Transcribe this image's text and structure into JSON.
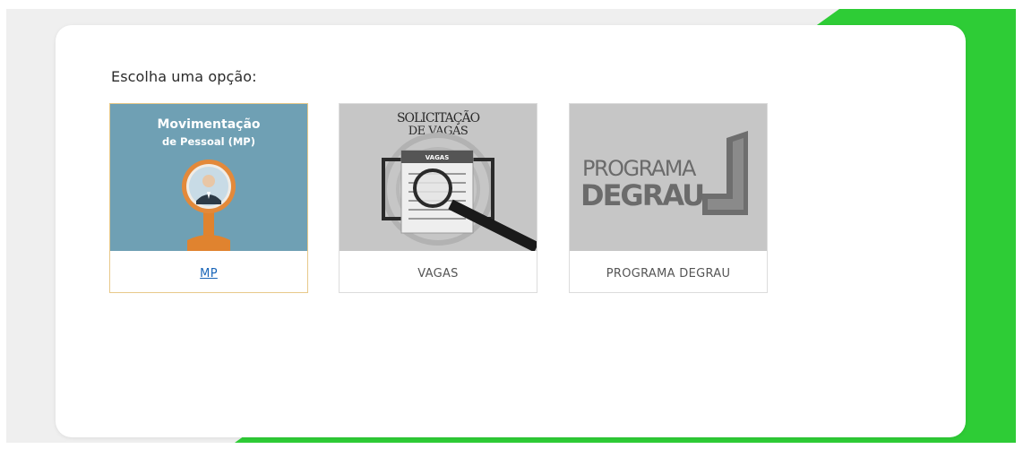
{
  "prompt": "Escolha uma opção:",
  "colors": {
    "accent_green": "#2ecc36",
    "mp_thumb_bg": "#6fa0b4",
    "card_bg": "#ffffff"
  },
  "options": [
    {
      "label": "MP",
      "thumb_title_line1": "Movimentação",
      "thumb_title_line2": "de Pessoal (MP)",
      "thumb_icon": "magnifier-person-icon",
      "selected": true
    },
    {
      "label": "VAGAS",
      "thumb_title_line1": "SOLICITAÇÃO",
      "thumb_title_line2": "DE VAGAS",
      "thumb_paper_heading": "VAGAS",
      "thumb_icon": "newspaper-magnifier-icon",
      "selected": false
    },
    {
      "label": "PROGRAMA DEGRAU",
      "thumb_title_line1": "PROGRAMA",
      "thumb_title_line2": "DEGRAU",
      "thumb_icon": "stairs-logo-icon",
      "selected": false
    }
  ]
}
